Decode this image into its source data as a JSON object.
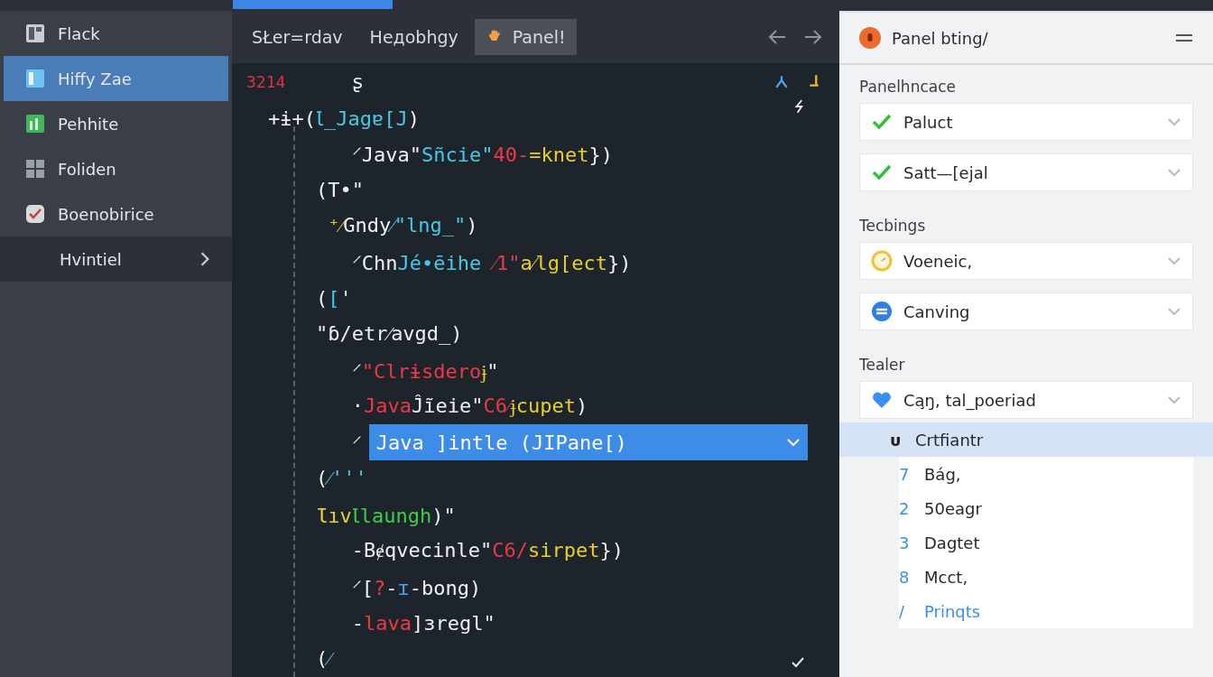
{
  "sidebar": {
    "items": [
      {
        "label": "Flack",
        "kind": "panel",
        "selected": false
      },
      {
        "label": "Hiffy Zae",
        "kind": "doc",
        "selected": true
      },
      {
        "label": "Pehhite",
        "kind": "chart",
        "selected": false
      },
      {
        "label": "Foliden",
        "kind": "grid",
        "selected": false
      },
      {
        "label": "Boenobirice",
        "kind": "check",
        "selected": false
      },
      {
        "label": "Hvintiel",
        "kind": "group",
        "selected": false
      }
    ]
  },
  "tabs": [
    {
      "label": "SŁer=rdav",
      "selected": false,
      "kind": "plain"
    },
    {
      "label": "Hедobhgy",
      "selected": false,
      "kind": "plain"
    },
    {
      "label": "Panel!",
      "selected": true,
      "kind": "hand"
    }
  ],
  "editor": {
    "lines": [
      {
        "number": "3214",
        "tokens": [
          {
            "text": "       ʂ",
            "kind": "plain"
          }
        ]
      },
      {
        "tokens": [
          {
            "text": "+ɨ+(",
            "kind": "plain"
          },
          {
            "text": "Ꙇ_Jagɐ[J",
            "kind": "cyan"
          },
          {
            "text": ")",
            "kind": "plain"
          }
        ]
      },
      {
        "tokens": [
          {
            "text": "       ⸍Java\"",
            "kind": "plain"
          },
          {
            "text": "Sñcie\"",
            "kind": "cyan"
          },
          {
            "text": "40-",
            "kind": "red"
          },
          {
            "text": "=knet",
            "kind": "yellow"
          },
          {
            "text": "})",
            "kind": "plain"
          }
        ]
      },
      {
        "tokens": [
          {
            "text": "    (T•\"",
            "kind": "plain"
          }
        ]
      },
      {
        "tokens": [
          {
            "text": "     ⁺⁄",
            "kind": "yellow"
          },
          {
            "text": "Gndy",
            "kind": "plain"
          },
          {
            "text": "⁄\"lng_\"",
            "kind": "cyan"
          },
          {
            "text": ")",
            "kind": "plain"
          }
        ]
      },
      {
        "tokens": [
          {
            "text": "       ⸍Chn",
            "kind": "plain"
          },
          {
            "text": "Jé∙ēihe ",
            "kind": "cyan"
          },
          {
            "text": "⁄1\"",
            "kind": "red"
          },
          {
            "text": "a⁄lg[ect",
            "kind": "yellow"
          },
          {
            "text": "})",
            "kind": "plain"
          }
        ]
      },
      {
        "tokens": [
          {
            "text": "    (",
            "kind": "plain"
          },
          {
            "text": "[",
            "kind": "cyan"
          },
          {
            "text": "'",
            "kind": "plain"
          }
        ]
      },
      {
        "tokens": [
          {
            "text": "    \"ɓ/etr⁄avgd_)",
            "kind": "plain"
          }
        ]
      },
      {
        "tokens": [
          {
            "text": "       ⸍",
            "kind": "plain"
          },
          {
            "text": "\"Clrɨsdero",
            "kind": "red"
          },
          {
            "text": "ɉ",
            "kind": "yellow"
          },
          {
            "text": "\"",
            "kind": "plain"
          }
        ]
      },
      {
        "tokens": [
          {
            "text": "       ·",
            "kind": "plain"
          },
          {
            "text": "Java",
            "kind": "red"
          },
          {
            "text": "Ĵĩeie\"",
            "kind": "plain"
          },
          {
            "text": "C6⁄",
            "kind": "red"
          },
          {
            "text": "ɉcupet",
            "kind": "yellow"
          },
          {
            "text": ")",
            "kind": "plain"
          }
        ]
      },
      {
        "tokens": [
          {
            "text": "       ⸍",
            "kind": "plain"
          }
        ],
        "suggestion": "Java ]intle (JIPane[)"
      },
      {
        "tokens": [
          {
            "text": "    (",
            "kind": "plain"
          },
          {
            "text": "⁄'''",
            "kind": "cyan"
          }
        ]
      },
      {
        "tokens": [
          {
            "text": "    Ɩıv",
            "kind": "yellow"
          },
          {
            "text": "Ꙇlaungh",
            "kind": "green"
          },
          {
            "text": ")\"",
            "kind": "plain"
          }
        ]
      },
      {
        "tokens": [
          {
            "text": "       -Bɇqvecinle\"",
            "kind": "plain"
          },
          {
            "text": "C6/",
            "kind": "red"
          },
          {
            "text": "sirpet",
            "kind": "yellow"
          },
          {
            "text": "})",
            "kind": "plain"
          }
        ]
      },
      {
        "tokens": [
          {
            "text": "       ⸍[",
            "kind": "plain"
          },
          {
            "text": "?",
            "kind": "red"
          },
          {
            "text": "-",
            "kind": "plain"
          },
          {
            "text": "ɪ",
            "kind": "blue"
          },
          {
            "text": "-bong)",
            "kind": "plain"
          }
        ]
      },
      {
        "tokens": [
          {
            "text": "       -",
            "kind": "plain"
          },
          {
            "text": "lava",
            "kind": "red"
          },
          {
            "text": "]ɜregl\"",
            "kind": "plain"
          }
        ]
      },
      {
        "tokens": [
          {
            "text": "    (",
            "kind": "plain"
          },
          {
            "text": "⁄",
            "kind": "cyan"
          }
        ]
      }
    ]
  },
  "panel": {
    "title": "Panel bting/",
    "sections": [
      {
        "label": "Panelhncace",
        "dropdowns": [
          {
            "value": "Paluct",
            "kind": "check"
          },
          {
            "value": "Satt—[ejal",
            "kind": "check"
          }
        ]
      },
      {
        "label": "Tecbings",
        "dropdowns": [
          {
            "value": "Voeneic,",
            "kind": "clock"
          },
          {
            "value": "Canving",
            "kind": "sync"
          }
        ]
      },
      {
        "label": "Tealer",
        "dropdowns": [
          {
            "value": "Ca̧ŋ, tal_poeriad",
            "kind": "heart"
          }
        ],
        "list": [
          {
            "number": "ᴜ",
            "label": "Crtfiantr",
            "selected": true,
            "kind": "item"
          },
          {
            "number": "7",
            "label": "Bág,",
            "selected": false,
            "kind": "item"
          },
          {
            "number": "2",
            "label": "50eagr",
            "selected": false,
            "kind": "item"
          },
          {
            "number": "3",
            "label": "Dagtet",
            "selected": false,
            "kind": "item"
          },
          {
            "number": "8",
            "label": "Mcct,",
            "selected": false,
            "kind": "item"
          },
          {
            "number": "/",
            "label": "Prinqts",
            "selected": false,
            "kind": "link"
          }
        ]
      }
    ]
  }
}
